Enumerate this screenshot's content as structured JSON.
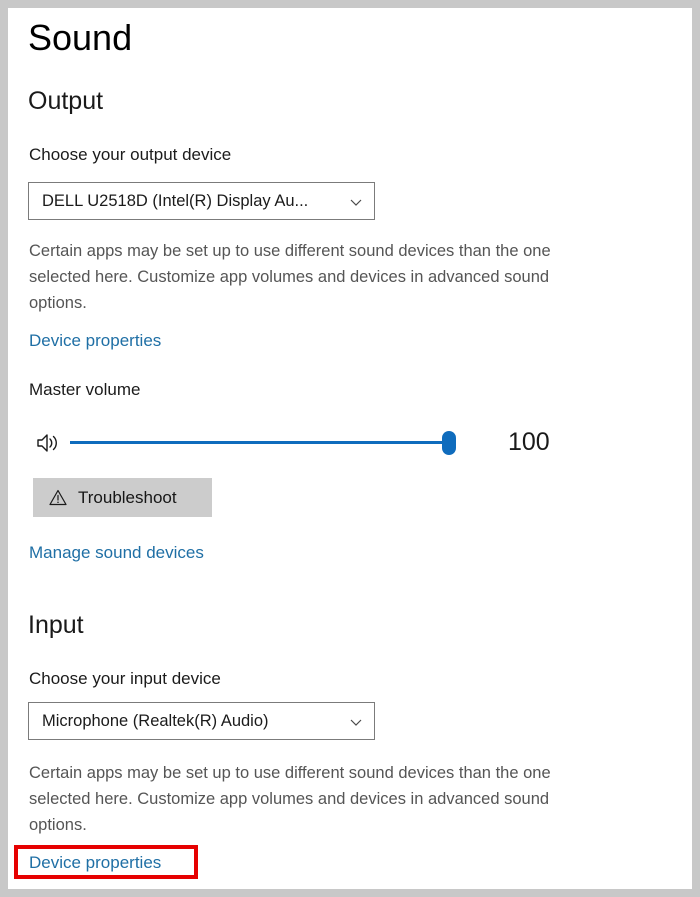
{
  "window": {
    "title": "Sound",
    "frame_color": "#c8c8c8",
    "surface_color": "#ffffff"
  },
  "theme": {
    "link_color": "#1f6fa5",
    "accent_color": "#0f6cbd",
    "button_bg": "#cccccc",
    "annotation_color": "#e60000",
    "body_text_color": "#555555"
  },
  "output": {
    "heading": "Output",
    "device_label": "Choose your output device",
    "device_value": "DELL U2518D (Intel(R) Display Au...",
    "description": "Certain apps may be set up to use different sound devices than the one selected here. Customize app volumes and devices in advanced sound options.",
    "device_properties_link": "Device properties",
    "volume_label": "Master volume",
    "volume_value": "100",
    "volume_min": 0,
    "volume_max": 100,
    "troubleshoot_label": "Troubleshoot",
    "manage_devices_link": "Manage sound devices"
  },
  "input": {
    "heading": "Input",
    "device_label": "Choose your input device",
    "device_value": "Microphone (Realtek(R) Audio)",
    "description": "Certain apps may be set up to use different sound devices than the one selected here. Customize app volumes and devices in advanced sound options.",
    "device_properties_link": "Device properties"
  },
  "icons": {
    "speaker": "speaker-volume-icon",
    "warning": "warning-triangle-icon",
    "chevron": "chevron-down-icon"
  }
}
